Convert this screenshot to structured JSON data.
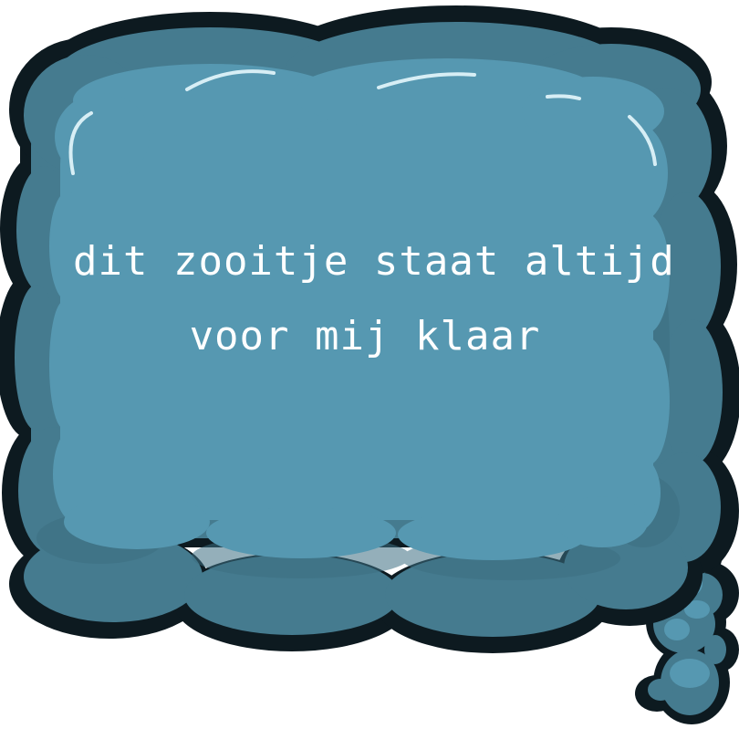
{
  "thought_bubble": {
    "lines": [
      "dit zooitje staat altijd",
      "voor mij klaar"
    ],
    "colors": {
      "outline": "#0d1a20",
      "outer_fill": "#457b8f",
      "inner_fill": "#5698b1",
      "shade": "#3d6f82",
      "highlight": "#d7eef5",
      "text": "#ffffff"
    }
  }
}
